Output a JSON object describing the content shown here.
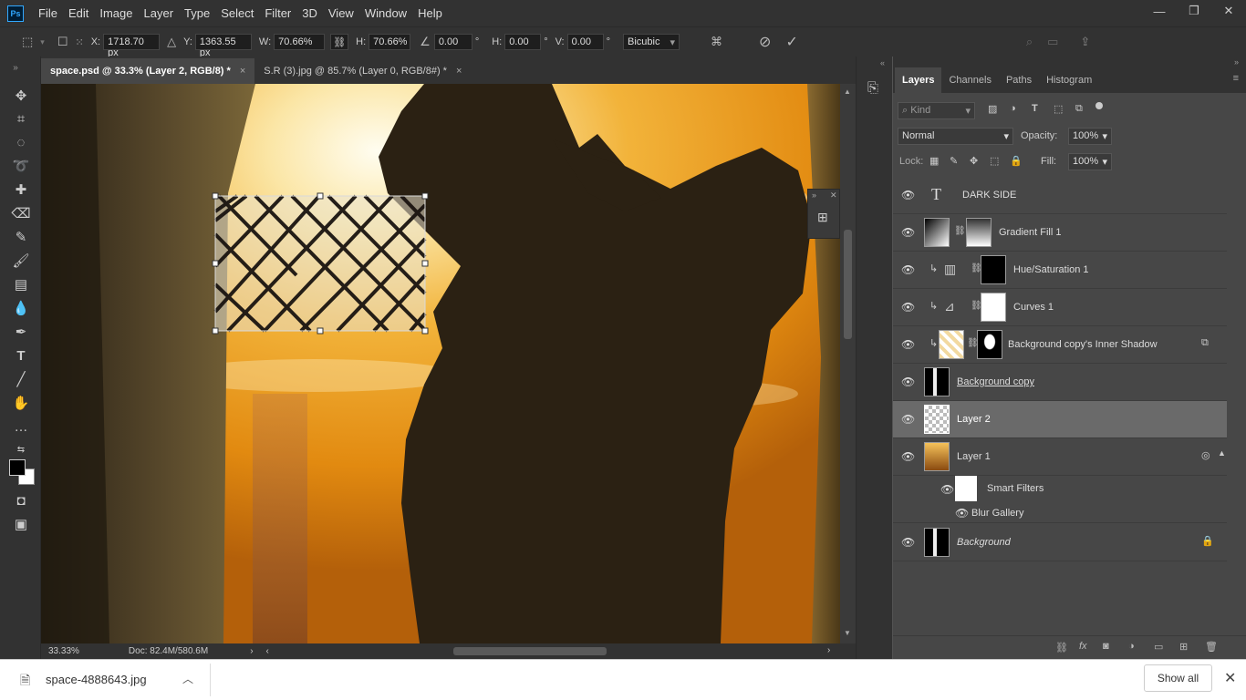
{
  "menu": [
    "File",
    "Edit",
    "Image",
    "Layer",
    "Type",
    "Select",
    "Filter",
    "3D",
    "View",
    "Window",
    "Help"
  ],
  "options": {
    "x_label": "X:",
    "x_value": "1718.70 px",
    "y_label": "Y:",
    "y_value": "1363.55 px",
    "w_label": "W:",
    "w_value": "70.66%",
    "h_label": "H:",
    "h_value": "70.66%",
    "angle_value": "0.00",
    "deg": "°",
    "hskew_label": "H:",
    "hskew_value": "0.00",
    "vskew_label": "V:",
    "vskew_value": "0.00",
    "interpolation": "Bicubic"
  },
  "tabs": [
    {
      "label": "space.psd @ 33.3% (Layer 2, RGB/8) *"
    },
    {
      "label": "S.R (3).jpg @ 85.7% (Layer 0, RGB/8#) *"
    }
  ],
  "status": {
    "zoom": "33.33%",
    "doc": "Doc: 82.4M/580.6M"
  },
  "panel_tabs": [
    "Layers",
    "Channels",
    "Paths",
    "Histogram"
  ],
  "layers_ui": {
    "kind_placeholder": "Kind",
    "blend_mode": "Normal",
    "opacity_label": "Opacity:",
    "opacity_value": "100%",
    "lock_label": "Lock:",
    "fill_label": "Fill:",
    "fill_value": "100%"
  },
  "layers": [
    {
      "name": "DARK SIDE"
    },
    {
      "name": "Gradient Fill 1"
    },
    {
      "name": "Hue/Saturation 1"
    },
    {
      "name": "Curves 1"
    },
    {
      "name": "Background copy's Inner Shadow"
    },
    {
      "name": "Background copy"
    },
    {
      "name": "Layer 2"
    },
    {
      "name": "Layer 1"
    },
    {
      "name": "Smart Filters"
    },
    {
      "name": "Blur Gallery"
    },
    {
      "name": "Background"
    }
  ],
  "download": {
    "filename": "space-4888643.jpg",
    "show_all": "Show all"
  },
  "colors": {
    "accent": "#31a8ff",
    "panel": "#474747",
    "dark": "#323232"
  }
}
